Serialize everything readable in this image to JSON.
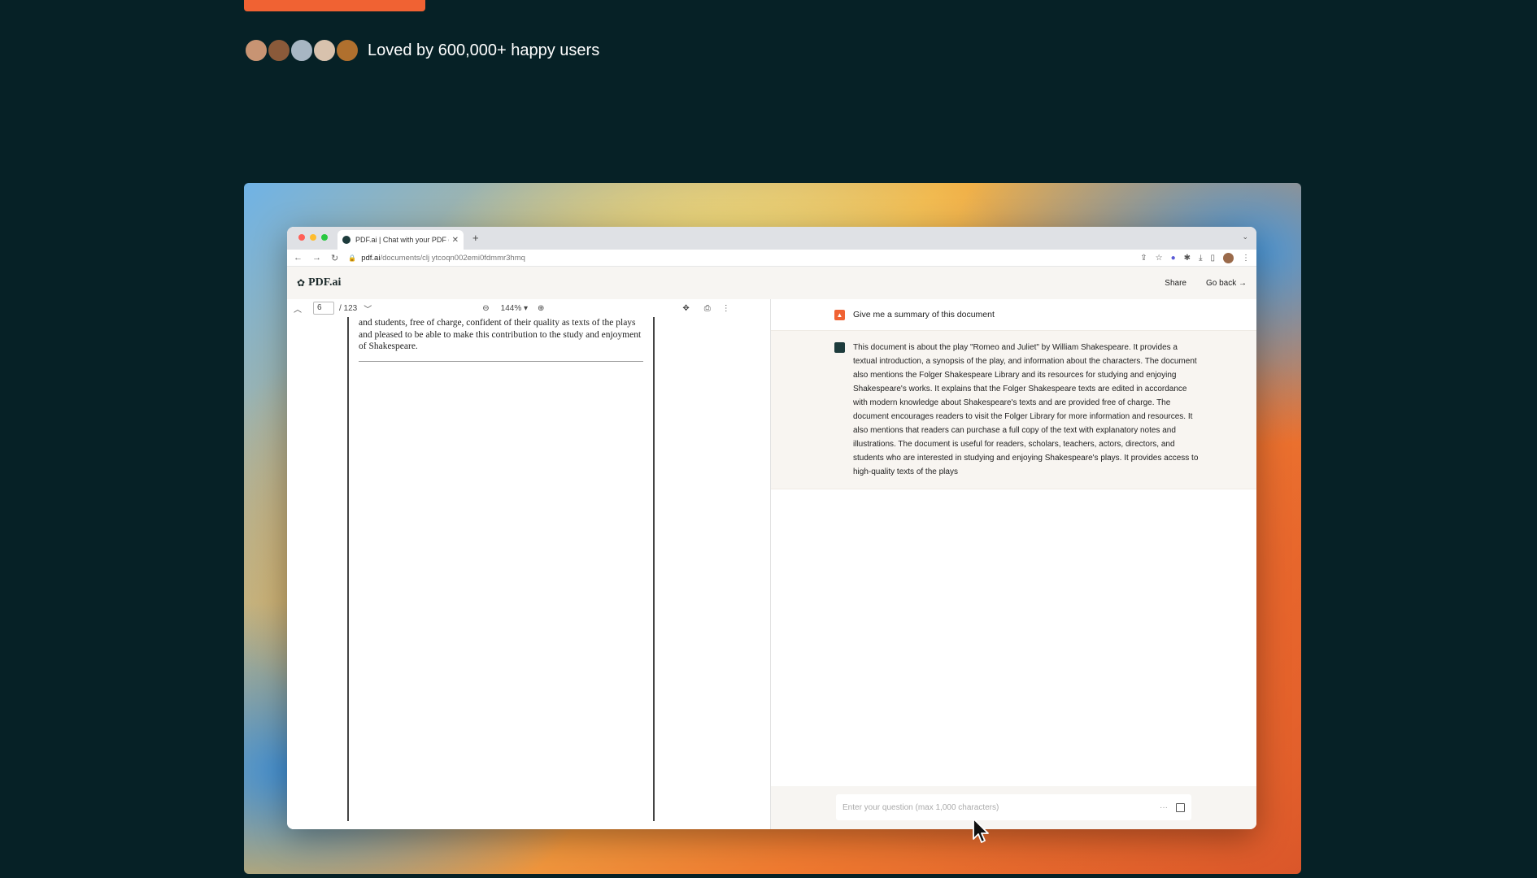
{
  "social": {
    "text": "Loved by 600,000+ happy users",
    "avatar_colors": [
      "#c89473",
      "#8a5a3a",
      "#a7b6c3",
      "#d8c2ad",
      "#b0702e"
    ]
  },
  "browser": {
    "tab_title": "PDF.ai | Chat with your PDF do",
    "new_tab": "+",
    "url_domain": "pdf.ai",
    "url_path": "/documents/clj ytcoqn002emi0fdmmr3hmq"
  },
  "app": {
    "logo": "PDF.ai",
    "share_label": "Share",
    "goback_label": "Go back →"
  },
  "pdf_viewer": {
    "page_number": "6",
    "page_total": "/ 123",
    "zoom": "144% ▾",
    "page_text": "and students, free of charge, confident of their quality as texts of the plays and pleased to be able to make this contribution to the study and enjoyment of Shakespeare."
  },
  "chat": {
    "question": "Give me a summary of this document",
    "answer": "This document is about the play \"Romeo and Juliet\" by William Shakespeare. It provides a textual introduction, a synopsis of the play, and information about the characters. The document also mentions the Folger Shakespeare Library and its resources for studying and enjoying Shakespeare's works. It explains that the Folger Shakespeare texts are edited in accordance with modern knowledge about Shakespeare's texts and are provided free of charge. The document encourages readers to visit the Folger Library for more information and resources. It also mentions that readers can purchase a full copy of the text with explanatory notes and illustrations. The document is useful for readers, scholars, teachers, actors, directors, and students who are interested in studying and enjoying Shakespeare's plays. It provides access to high-quality texts of the plays",
    "input_placeholder": "Enter your question (max 1,000 characters)"
  }
}
